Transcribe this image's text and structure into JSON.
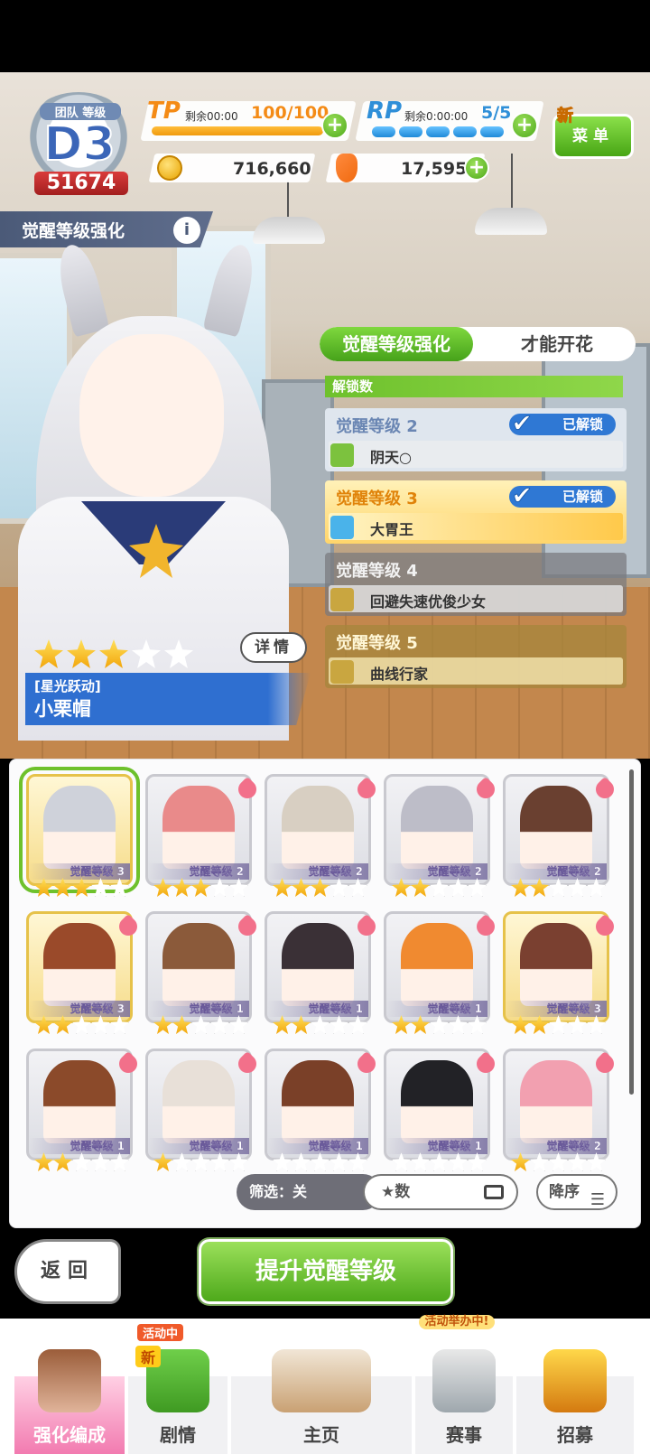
{
  "colors": {
    "accent_green": "#5cb81f",
    "tp_orange": "#f48b16",
    "rp_blue": "#2f8fd8",
    "header_navy": "#4b5a78"
  },
  "rank": {
    "team_label": "团队  等级",
    "grade": "D3",
    "score": "51674"
  },
  "tp": {
    "label": "TP",
    "timer": "剩余00:00",
    "value": "100/100",
    "fill_fraction": 1.0
  },
  "rp": {
    "label": "RP",
    "timer": "剩余0:00:00",
    "value": "5/5"
  },
  "menu": {
    "new_badge": "新",
    "label": "菜单"
  },
  "currency": {
    "coins": "716,660",
    "carrots": "17,595"
  },
  "section": {
    "title": "觉醒等级强化",
    "info_icon": "i"
  },
  "character": {
    "epithet": "[星光跃动]",
    "name": "小栗帽",
    "stars": 3,
    "max_stars": 5,
    "detail_button": "详情"
  },
  "panel": {
    "tab_active": "觉醒等级强化",
    "tab_other": "才能开花",
    "unlock_header": "解锁数",
    "levels": [
      {
        "title": "觉醒等级  2",
        "skill": "阴天○",
        "status": "已解锁"
      },
      {
        "title": "觉醒等级  3",
        "skill": "大胃王",
        "status": "已解锁"
      },
      {
        "title": "觉醒等级  4",
        "skill": "回避失速优俊少女",
        "status": ""
      },
      {
        "title": "觉醒等级  5",
        "skill": "曲线行家",
        "status": ""
      }
    ]
  },
  "roster": [
    {
      "level": "觉醒等级 3",
      "stars": 3
    },
    {
      "level": "觉醒等级 2",
      "stars": 3
    },
    {
      "level": "觉醒等级 2",
      "stars": 3
    },
    {
      "level": "觉醒等级 2",
      "stars": 2
    },
    {
      "level": "觉醒等级 2",
      "stars": 2
    },
    {
      "level": "觉醒等级 3",
      "stars": 2
    },
    {
      "level": "觉醒等级 1",
      "stars": 2
    },
    {
      "level": "觉醒等级 1",
      "stars": 2
    },
    {
      "level": "觉醒等级 1",
      "stars": 2
    },
    {
      "level": "觉醒等级 3",
      "stars": 2
    },
    {
      "level": "觉醒等级 1",
      "stars": 2
    },
    {
      "level": "觉醒等级 1",
      "stars": 1
    },
    {
      "level": "觉醒等级 1",
      "stars": 0
    },
    {
      "level": "觉醒等级 1",
      "stars": 0
    },
    {
      "level": "觉醒等级 2",
      "stars": 1
    }
  ],
  "filter": {
    "label": "筛选：关",
    "sort_key": "★数",
    "sort_order": "降序"
  },
  "actions": {
    "back": "返回",
    "raise": "提升觉醒等级"
  },
  "nav": {
    "items": [
      {
        "label": "强化编成"
      },
      {
        "label": "剧情",
        "tag": "活动中",
        "badge": "新"
      },
      {
        "label": "主页"
      },
      {
        "label": "赛事",
        "tag": "活动举办中!"
      },
      {
        "label": "招募"
      }
    ]
  }
}
